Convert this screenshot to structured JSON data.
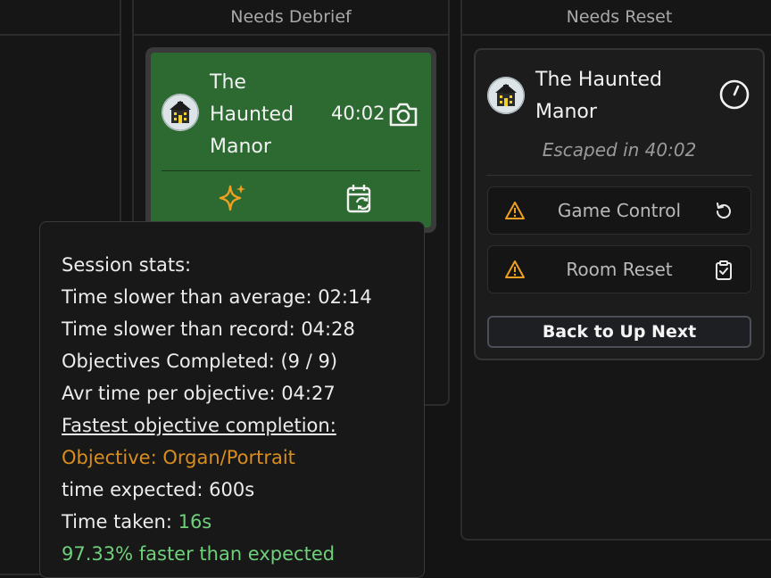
{
  "columns": {
    "debrief_title": "Needs Debrief",
    "reset_title": "Needs Reset"
  },
  "debrief_card": {
    "title_lines": [
      "The",
      "Haunted",
      "Manor"
    ],
    "time": "40:02",
    "icons": [
      "haunted-house-icon",
      "camera-icon",
      "sparkle-icon",
      "calendar-sync-icon"
    ]
  },
  "tooltip": {
    "heading": "Session stats:",
    "slower_avg": "Time slower than average: 02:14",
    "slower_record": "Time slower than record: 04:28",
    "objectives_completed": "Objectives Completed: (9 / 9)",
    "avg_per_objective": "Avr time per objective: 04:27",
    "fastest_heading": "Fastest objective completion:",
    "objective": "Objective: Organ/Portrait",
    "time_expected": "time expected: 600s",
    "time_taken_label": "Time taken: ",
    "time_taken_value": "16s",
    "faster_text": "97.33% faster than expected"
  },
  "reset_card": {
    "title_lines": [
      "The Haunted",
      "Manor"
    ],
    "escaped": "Escaped in 40:02",
    "game_control": "Game Control",
    "room_reset": "Room Reset",
    "back_button": "Back to Up Next",
    "icons": [
      "haunted-house-icon",
      "timer-icon",
      "warning-icon",
      "reset-icon",
      "clipboard-check-icon"
    ]
  },
  "colors": {
    "card_green": "#2d6a31",
    "accent_orange": "#f0a020",
    "objective_orange": "#d88d1d",
    "success_green": "#6fd07a"
  }
}
